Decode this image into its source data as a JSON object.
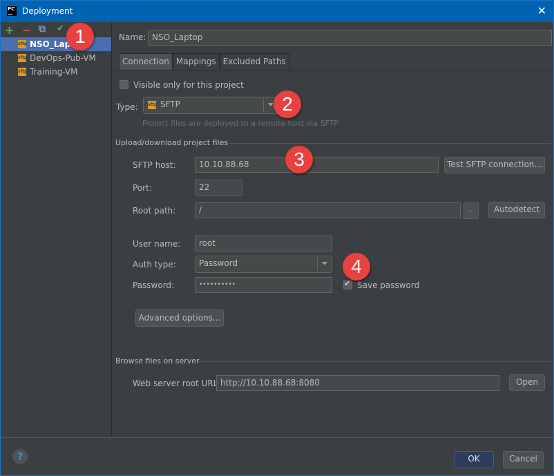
{
  "window": {
    "title": "Deployment",
    "app_icon": "PC"
  },
  "sidebar": {
    "toolbar": [
      {
        "name": "add",
        "glyph": "+",
        "color": "#59a869"
      },
      {
        "name": "remove",
        "glyph": "−",
        "color": "#c75450"
      },
      {
        "name": "copy",
        "glyph": "⧉",
        "color": "#6e9ecf"
      },
      {
        "name": "use-as-default",
        "glyph": "✔",
        "color": "#59a869"
      }
    ],
    "servers": [
      {
        "label": "NSO_Laptop",
        "icon": "sftp",
        "selected": true
      },
      {
        "label": "DevOps-Pub-VM",
        "icon": "sftp",
        "selected": false
      },
      {
        "label": "Training-VM",
        "icon": "sftp",
        "selected": false
      }
    ]
  },
  "main": {
    "name_label": "Name:",
    "name_value": "NSO_Laptop",
    "tabs": [
      {
        "label": "Connection",
        "active": true
      },
      {
        "label": "Mappings",
        "active": false
      },
      {
        "label": "Excluded Paths",
        "active": false
      }
    ],
    "visible_only_label": "Visible only for this project",
    "visible_only_checked": false,
    "type_label": "Type:",
    "type_value": "SFTP",
    "type_hint": "Project files are deployed to a remote host via SFTP",
    "upload_section": "Upload/download project files",
    "host_label": "SFTP host:",
    "host_value": "10.10.88.68",
    "test_button": "Test SFTP connection...",
    "port_label": "Port:",
    "port_value": "22",
    "root_label": "Root path:",
    "root_value": "/",
    "browse_button": "...",
    "autodetect_button": "Autodetect",
    "user_label": "User name:",
    "user_value": "root",
    "auth_label": "Auth type:",
    "auth_value": "Password",
    "password_label": "Password:",
    "password_value": "••••••••••",
    "save_password_label": "Save password",
    "save_password_checked": true,
    "advanced_button": "Advanced options...",
    "browse_section": "Browse files on server",
    "web_url_label": "Web server root URL:",
    "web_url_value": "http://10.10.88.68:8080",
    "open_button": "Open"
  },
  "footer": {
    "help": "?",
    "ok": "OK",
    "cancel": "Cancel"
  },
  "annotations": [
    "1",
    "2",
    "3",
    "4"
  ]
}
